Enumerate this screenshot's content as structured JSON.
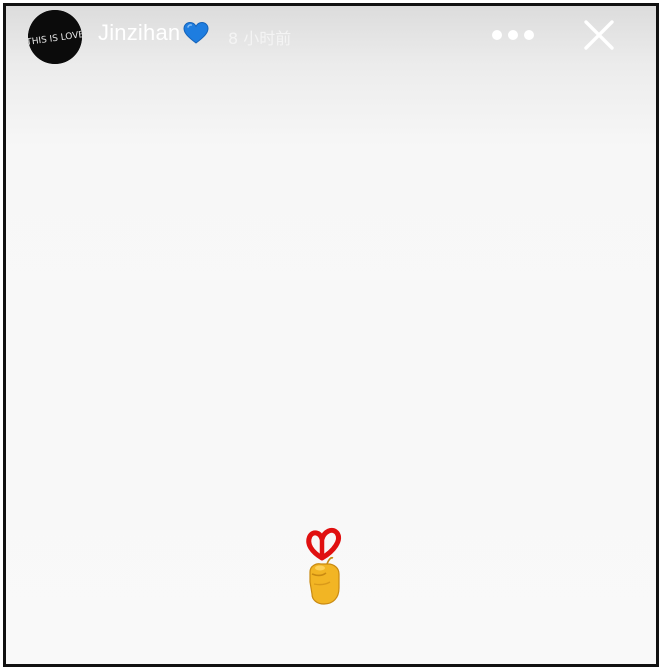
{
  "story": {
    "avatar": {
      "icon": "avatar-logo",
      "text": "THIS IS LOVE"
    },
    "username": "Jinzihan",
    "username_badge_icon": "blue-heart-icon",
    "timestamp": "8 小时前",
    "more_icon": "more-dots-icon",
    "close_icon": "close-icon"
  },
  "content": {
    "sticker_icon": "finger-heart-hand-icon"
  },
  "colors": {
    "header_gradient_top": "#dcdcdc",
    "background": "#f9f9f9",
    "heart_blue": "#1e7de0",
    "sticker_red": "#e01010",
    "hand_yellow": "#f2b524"
  }
}
